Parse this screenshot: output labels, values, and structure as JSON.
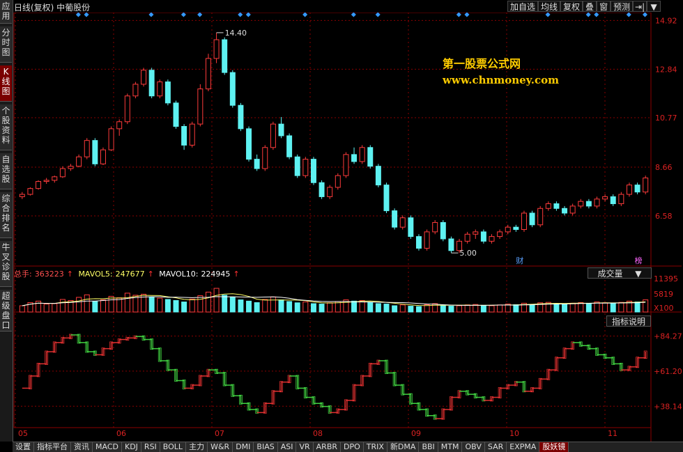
{
  "window": {
    "title": "日线(复权) 中葡股份"
  },
  "toolbar": {
    "items": [
      "加自选",
      "均线",
      "复权",
      "叠",
      "窗",
      "预测"
    ],
    "icon_label": "⇥|",
    "menu_arrow": "▼"
  },
  "sidebar": {
    "tabs": [
      {
        "label": "应用",
        "active": false
      },
      {
        "label": "分时图",
        "active": false
      },
      {
        "label": "K线图",
        "active": true
      },
      {
        "label": "个股资料",
        "active": false
      },
      {
        "label": "自选股",
        "active": false
      },
      {
        "label": "综合排名",
        "active": false
      },
      {
        "label": "牛叉诊股",
        "active": false
      },
      {
        "label": "超级盘口",
        "active": false
      }
    ]
  },
  "price_panel": {
    "y_ticks": [
      "14.92",
      "12.84",
      "10.77",
      "8.66",
      "6.58"
    ],
    "high_annotation": "14.40",
    "low_annotation": "5.00",
    "badge_cai": "财",
    "badge_bang": "榜",
    "watermark_line1": "第一股票公式网",
    "watermark_line2": "www.chnmoney.com"
  },
  "volume_panel": {
    "total_label": "总手:",
    "total_value": "363223",
    "mavol5_label": "MAVOL5:",
    "mavol5_value": "247677",
    "mavol10_label": "MAVOL10:",
    "mavol10_value": "224945",
    "up_arrow": "↑",
    "dropdown_label": "成交量",
    "dropdown_arrow": "▼",
    "y_ticks": [
      "11395",
      "5819"
    ],
    "multiplier": "X100"
  },
  "indicator_panel": {
    "button_label": "指标说明",
    "y_ticks": [
      "+84.27",
      "+61.20",
      "+38.14"
    ]
  },
  "x_axis": {
    "months": [
      "05",
      "06",
      "07",
      "08",
      "09",
      "10",
      "11"
    ]
  },
  "bottom_tabs": [
    "设置",
    "指标平台",
    "资讯",
    "MACD",
    "KDJ",
    "RSI",
    "BOLL",
    "主力",
    "W&R",
    "DMI",
    "BIAS",
    "ASI",
    "VR",
    "ARBR",
    "DPO",
    "TRIX",
    "新DMA",
    "BBI",
    "MTM",
    "OBV",
    "SAR",
    "EXPMA",
    "股妖镜"
  ],
  "bottom_active_tab": "股妖镜",
  "colors": {
    "up": "#ff3b3b",
    "down": "#5ef2f2",
    "grid": "#8b0000",
    "indicator_up": "#e03030",
    "indicator_down": "#40d040",
    "marker": "#3399ff",
    "watermark": "#ffcc00"
  },
  "chart_data": {
    "type": "candlestick",
    "price_range": [
      4.5,
      15.2
    ],
    "candles": [
      [
        7.4,
        7.6,
        7.3,
        7.5
      ],
      [
        7.5,
        7.8,
        7.45,
        7.75
      ],
      [
        7.75,
        8.1,
        7.7,
        8.05
      ],
      [
        8.05,
        8.2,
        7.95,
        8.1
      ],
      [
        8.1,
        8.3,
        8.0,
        8.25
      ],
      [
        8.25,
        8.7,
        8.2,
        8.6
      ],
      [
        8.6,
        8.8,
        8.5,
        8.7
      ],
      [
        8.7,
        9.2,
        8.65,
        9.1
      ],
      [
        9.1,
        9.9,
        9.0,
        9.8
      ],
      [
        9.8,
        9.9,
        8.7,
        8.8
      ],
      [
        8.8,
        9.5,
        8.75,
        9.4
      ],
      [
        9.4,
        10.4,
        9.35,
        10.3
      ],
      [
        10.3,
        10.7,
        10.0,
        10.6
      ],
      [
        10.6,
        11.8,
        10.5,
        11.7
      ],
      [
        11.7,
        12.3,
        11.6,
        12.2
      ],
      [
        12.2,
        12.9,
        12.1,
        12.8
      ],
      [
        12.8,
        12.9,
        11.6,
        11.7
      ],
      [
        11.7,
        12.4,
        11.6,
        12.3
      ],
      [
        12.3,
        12.4,
        11.3,
        11.4
      ],
      [
        11.4,
        11.5,
        10.3,
        10.4
      ],
      [
        10.4,
        10.5,
        9.4,
        9.6
      ],
      [
        9.6,
        10.6,
        9.5,
        10.5
      ],
      [
        10.5,
        12.2,
        10.4,
        12.0
      ],
      [
        12.0,
        13.5,
        11.9,
        13.3
      ],
      [
        13.3,
        14.4,
        13.1,
        14.1
      ],
      [
        14.1,
        14.2,
        12.6,
        12.7
      ],
      [
        12.7,
        12.8,
        11.2,
        11.3
      ],
      [
        11.3,
        11.4,
        10.2,
        10.3
      ],
      [
        10.3,
        10.4,
        8.9,
        9.0
      ],
      [
        9.0,
        9.2,
        8.5,
        8.6
      ],
      [
        8.6,
        9.6,
        8.5,
        9.5
      ],
      [
        9.5,
        10.6,
        9.4,
        10.5
      ],
      [
        10.5,
        10.8,
        9.9,
        10.0
      ],
      [
        10.0,
        10.1,
        9.0,
        9.1
      ],
      [
        9.1,
        9.2,
        8.2,
        8.3
      ],
      [
        8.3,
        9.1,
        8.2,
        9.0
      ],
      [
        9.0,
        9.1,
        7.9,
        8.0
      ],
      [
        8.0,
        8.1,
        7.3,
        7.4
      ],
      [
        7.4,
        7.9,
        7.3,
        7.8
      ],
      [
        7.8,
        8.4,
        7.7,
        8.3
      ],
      [
        8.3,
        9.3,
        8.2,
        9.2
      ],
      [
        9.2,
        9.5,
        8.8,
        8.9
      ],
      [
        8.9,
        9.6,
        8.8,
        9.5
      ],
      [
        9.5,
        9.6,
        8.6,
        8.7
      ],
      [
        8.7,
        8.8,
        7.8,
        7.9
      ],
      [
        7.9,
        8.0,
        6.7,
        6.8
      ],
      [
        6.8,
        6.9,
        6.0,
        6.1
      ],
      [
        6.1,
        6.6,
        6.0,
        6.5
      ],
      [
        6.5,
        6.6,
        5.6,
        5.7
      ],
      [
        5.7,
        5.8,
        5.1,
        5.2
      ],
      [
        5.2,
        6.0,
        5.1,
        5.9
      ],
      [
        5.9,
        6.4,
        5.8,
        6.3
      ],
      [
        6.3,
        6.4,
        5.5,
        5.6
      ],
      [
        5.6,
        5.7,
        5.0,
        5.1
      ],
      [
        5.1,
        5.6,
        5.0,
        5.5
      ],
      [
        5.5,
        5.9,
        5.4,
        5.8
      ],
      [
        5.8,
        6.0,
        5.6,
        5.9
      ],
      [
        5.9,
        6.0,
        5.4,
        5.5
      ],
      [
        5.5,
        5.8,
        5.4,
        5.7
      ],
      [
        5.7,
        6.0,
        5.6,
        5.9
      ],
      [
        5.9,
        6.2,
        5.8,
        6.1
      ],
      [
        6.1,
        6.2,
        5.9,
        6.0
      ],
      [
        6.0,
        6.8,
        5.9,
        6.7
      ],
      [
        6.7,
        6.8,
        6.1,
        6.2
      ],
      [
        6.2,
        7.0,
        6.1,
        6.9
      ],
      [
        6.9,
        7.2,
        6.8,
        7.1
      ],
      [
        7.1,
        7.2,
        6.8,
        6.9
      ],
      [
        6.9,
        7.0,
        6.6,
        6.7
      ],
      [
        6.7,
        7.1,
        6.6,
        7.0
      ],
      [
        7.0,
        7.3,
        6.9,
        7.2
      ],
      [
        7.2,
        7.3,
        6.9,
        7.0
      ],
      [
        7.0,
        7.4,
        6.9,
        7.3
      ],
      [
        7.3,
        7.5,
        7.2,
        7.4
      ],
      [
        7.4,
        7.5,
        7.0,
        7.1
      ],
      [
        7.1,
        7.6,
        7.0,
        7.5
      ],
      [
        7.5,
        8.0,
        7.4,
        7.9
      ],
      [
        7.9,
        8.0,
        7.5,
        7.6
      ],
      [
        7.6,
        8.3,
        7.5,
        8.2
      ]
    ],
    "volume": [
      30,
      45,
      52,
      38,
      40,
      60,
      55,
      70,
      82,
      50,
      58,
      75,
      68,
      90,
      80,
      85,
      72,
      66,
      60,
      55,
      48,
      62,
      78,
      95,
      113,
      80,
      70,
      58,
      52,
      45,
      60,
      72,
      58,
      50,
      44,
      48,
      40,
      38,
      44,
      50,
      58,
      52,
      55,
      46,
      40,
      38,
      30,
      34,
      28,
      26,
      35,
      40,
      32,
      28,
      30,
      34,
      36,
      32,
      30,
      34,
      38,
      35,
      42,
      36,
      44,
      46,
      40,
      38,
      42,
      45,
      42,
      48,
      44,
      40,
      46,
      52,
      48,
      58
    ],
    "indicator": [
      50,
      58,
      66,
      74,
      80,
      83,
      85,
      80,
      74,
      72,
      76,
      80,
      82,
      83,
      84,
      82,
      76,
      68,
      62,
      55,
      50,
      52,
      58,
      62,
      60,
      52,
      45,
      40,
      36,
      34,
      40,
      48,
      54,
      58,
      50,
      44,
      40,
      38,
      34,
      36,
      42,
      52,
      58,
      66,
      68,
      60,
      52,
      46,
      40,
      36,
      32,
      30,
      36,
      44,
      48,
      46,
      44,
      42,
      44,
      50,
      52,
      54,
      48,
      50,
      56,
      62,
      70,
      76,
      80,
      78,
      76,
      72,
      70,
      66,
      62,
      64,
      70,
      74
    ]
  }
}
